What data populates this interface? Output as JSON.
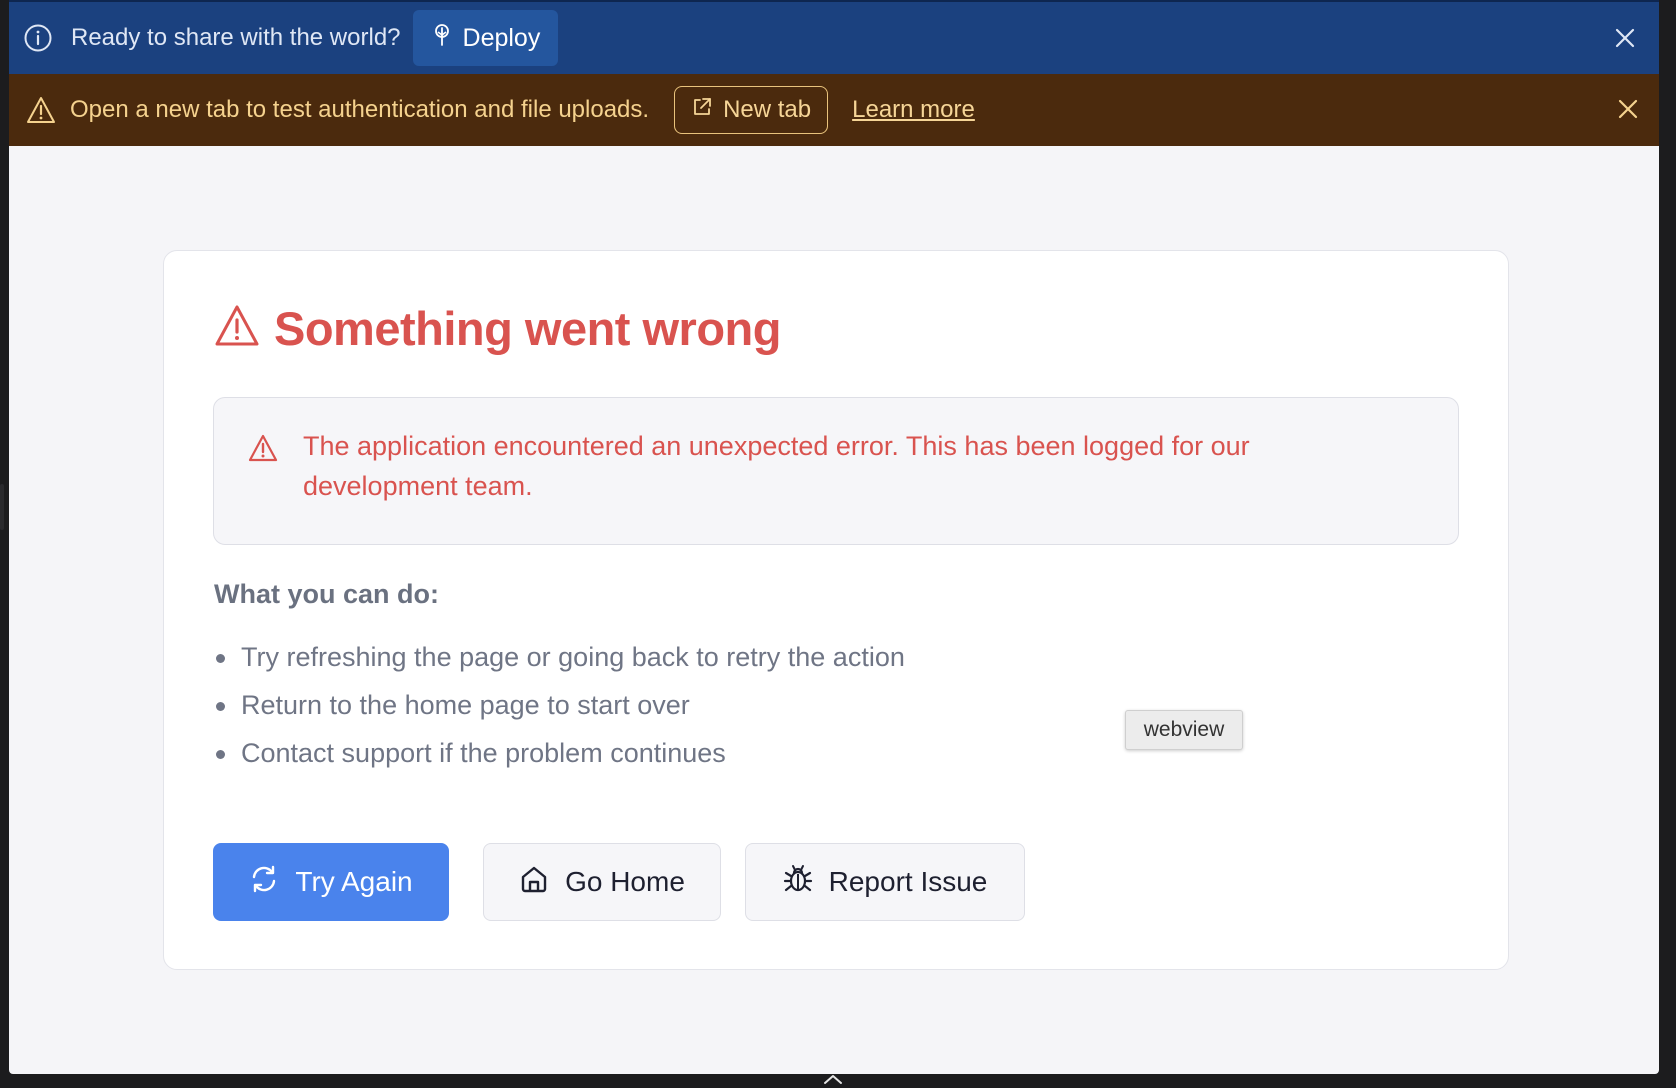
{
  "info_banner": {
    "text": "Ready to share with the world?",
    "deploy_label": "Deploy",
    "info_icon": "info-circle-icon",
    "close_icon": "close-icon"
  },
  "warning_banner": {
    "text": "Open a new tab to test authentication and file uploads.",
    "new_tab_label": "New tab",
    "learn_more_label": "Learn more",
    "warning_icon": "warning-triangle-icon",
    "close_icon": "close-icon"
  },
  "error_card": {
    "title": "Something went wrong",
    "alert_text": "The application encountered an unexpected error. This has been logged for our development team.",
    "what_heading": "What you can do:",
    "tips": [
      "Try refreshing the page or going back to retry the action",
      "Return to the home page to start over",
      "Contact support if the problem continues"
    ],
    "buttons": {
      "try_again": "Try Again",
      "go_home": "Go Home",
      "report_issue": "Report Issue"
    }
  },
  "tooltip": {
    "text": "webview"
  },
  "colors": {
    "info_bg": "#1b417f",
    "warn_bg": "#4b2a0d",
    "error_red": "#d9534f",
    "primary_blue": "#4a83ec"
  }
}
